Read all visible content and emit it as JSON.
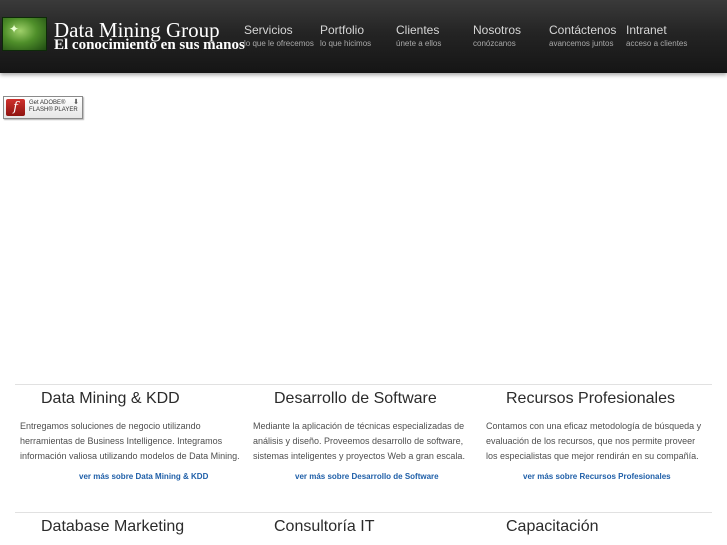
{
  "header": {
    "site_title": "Data Mining Group",
    "tagline": "El conocimiento en sus manos",
    "logo_icon": "grass-logo-icon"
  },
  "nav": [
    {
      "label": "Servicios",
      "sub": "lo que le ofrecemos"
    },
    {
      "label": "Portfolio",
      "sub": "lo que hicimos"
    },
    {
      "label": "Clientes",
      "sub": "únete a ellos"
    },
    {
      "label": "Nosotros",
      "sub": "conózcanos"
    },
    {
      "label": "Contáctenos",
      "sub": "avancemos juntos"
    },
    {
      "label": "Intranet",
      "sub": "acceso a clientes"
    }
  ],
  "flash_badge": {
    "line1": "Get ADOBE®",
    "line2": "FLASH® PLAYER",
    "icon": "flash-player-icon"
  },
  "features_row1": [
    {
      "title": "Data Mining & KDD",
      "description": "Entregamos soluciones de negocio utilizando herramientas de Business Intelligence. Integramos información valiosa utilizando modelos de Data Mining.",
      "link": "ver más sobre Data Mining & KDD"
    },
    {
      "title": "Desarrollo de Software",
      "description": "Mediante la aplicación de técnicas especializadas de análisis y diseño. Proveemos desarrollo de software, sistemas inteligentes y proyectos Web a gran escala.",
      "link": "ver más sobre Desarrollo de Software"
    },
    {
      "title": "Recursos Profesionales",
      "description": "Contamos con una eficaz metodología de búsqueda y evaluación de los recursos, que nos permite proveer los especialistas que mejor rendirán en su compañía.",
      "link": "ver más sobre Recursos Profesionales"
    }
  ],
  "features_row2": [
    {
      "title": "Database Marketing"
    },
    {
      "title": "Consultoría IT"
    },
    {
      "title": "Capacitación"
    }
  ],
  "colors": {
    "header_bg": "#1e1e1e",
    "link": "#1f5fa8",
    "title_text": "#2b2b2b"
  }
}
